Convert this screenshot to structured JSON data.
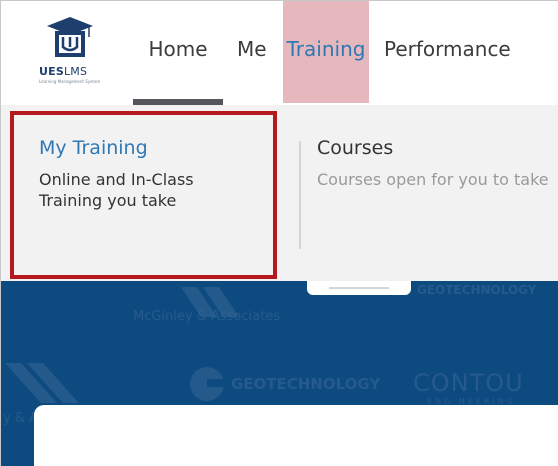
{
  "logo": {
    "brand_bold": "UES",
    "brand_light": "LMS",
    "tagline": "Learning Management System"
  },
  "nav": {
    "home": "Home",
    "me": "Me",
    "training": "Training",
    "performance": "Performance",
    "active": "Home",
    "highlighted": "Training"
  },
  "dropdown": {
    "my_training": {
      "title": "My Training",
      "description": "Online and In-Class Training you take"
    },
    "courses": {
      "title": "Courses",
      "description": "Courses open for you to take"
    }
  },
  "banner": {
    "watermarks": [
      "McGinley & Associates",
      "GEOTECHNOLOGY",
      "GEOTECHNOLOGY",
      "CONTOU",
      "ENG NEERING",
      "y & Associates"
    ]
  },
  "colors": {
    "link_blue": "#2f78b4",
    "highlight_red": "#b5181e",
    "banner_navy": "#0d4a80",
    "training_tab_pink": "#e5b8bd"
  }
}
